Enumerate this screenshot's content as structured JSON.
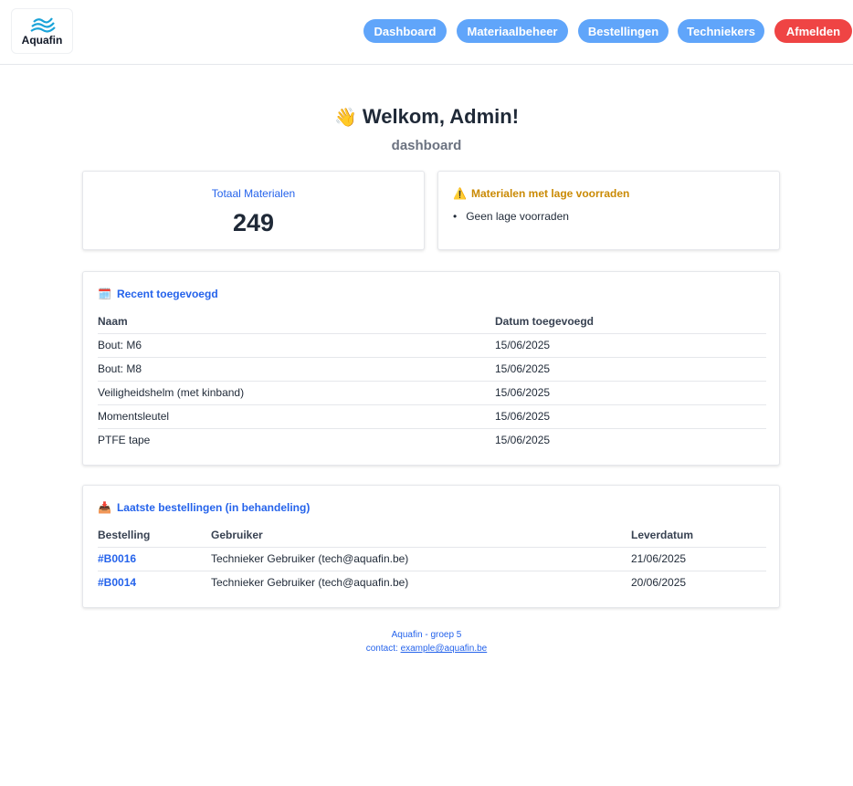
{
  "brand": {
    "name": "Aquafin"
  },
  "nav": {
    "items": [
      {
        "label": "Dashboard"
      },
      {
        "label": "Materiaalbeheer"
      },
      {
        "label": "Bestellingen"
      },
      {
        "label": "Techniekers"
      }
    ],
    "logout_label": "Afmelden"
  },
  "header": {
    "welcome": "Welkom, Admin!",
    "subtitle": "dashboard"
  },
  "stats": {
    "total_title": "Totaal Materialen",
    "total_value": "249"
  },
  "low_stock": {
    "title": "Materialen met lage voorraden",
    "items": [
      "Geen lage voorraden"
    ]
  },
  "recent": {
    "title": "Recent toegevoegd",
    "columns": [
      "Naam",
      "Datum toegevoegd"
    ],
    "rows": [
      [
        "Bout: M6",
        "15/06/2025"
      ],
      [
        "Bout: M8",
        "15/06/2025"
      ],
      [
        "Veiligheidshelm (met kinband)",
        "15/06/2025"
      ],
      [
        "Momentsleutel",
        "15/06/2025"
      ],
      [
        "PTFE tape",
        "15/06/2025"
      ]
    ]
  },
  "orders": {
    "title": "Laatste bestellingen (in behandeling)",
    "columns": [
      "Bestelling",
      "Gebruiker",
      "Leverdatum"
    ],
    "rows": [
      [
        "#B0016",
        "Technieker Gebruiker (tech@aquafin.be)",
        "21/06/2025"
      ],
      [
        "#B0014",
        "Technieker Gebruiker (tech@aquafin.be)",
        "20/06/2025"
      ]
    ]
  },
  "footer": {
    "line1": "Aquafin - groep 5",
    "contact_prefix": "contact:",
    "contact_email": "example@aquafin.be"
  },
  "colors": {
    "nav_button": "#60a5fa",
    "logout_button": "#ef4444",
    "link": "#2563eb",
    "warning": "#ca8a04"
  }
}
